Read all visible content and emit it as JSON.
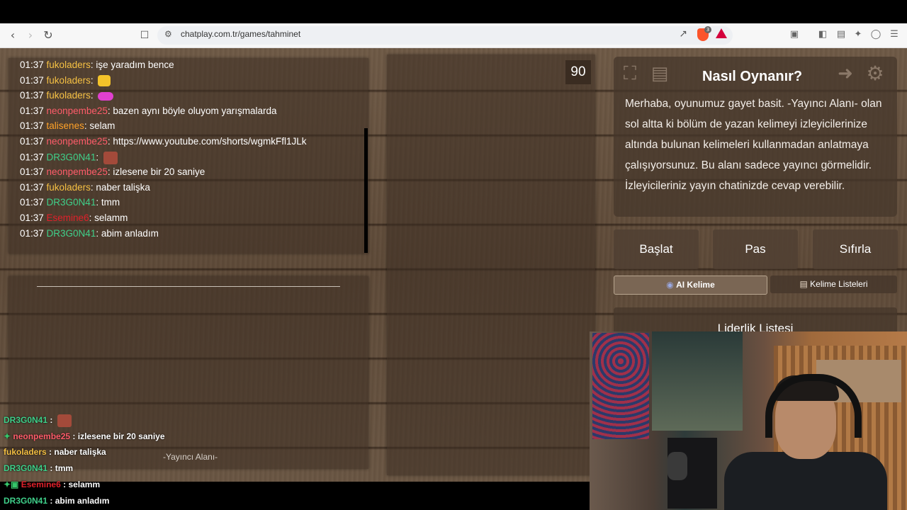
{
  "browser": {
    "url": "chatplay.com.tr/games/tahminet",
    "brave_badge": "3"
  },
  "chat": [
    {
      "time": "01:37",
      "user": "fukoladers",
      "color": "#f5c043",
      "sep": ": ",
      "msg": "işe yaradım bence",
      "emote": ""
    },
    {
      "time": "01:37",
      "user": "fukoladers",
      "color": "#f5c043",
      "sep": ": ",
      "msg": "",
      "emote": "cat"
    },
    {
      "time": "01:37",
      "user": "fukoladers",
      "color": "#f5c043",
      "sep": ": ",
      "msg": "",
      "emote": "bow"
    },
    {
      "time": "01:37",
      "user": "neonpembe25",
      "color": "#ff5c6a",
      "sep": ": ",
      "msg": "bazen aynı böyle oluyom yarışmalarda",
      "emote": ""
    },
    {
      "time": "01:37",
      "user": "talisenes",
      "color": "#ffa128",
      "sep": ": ",
      "msg": "selam",
      "emote": ""
    },
    {
      "time": "01:37",
      "user": "neonpembe25",
      "color": "#ff5c6a",
      "sep": ": ",
      "msg": "https://www.youtube.com/shorts/wgmkFfl1JLk",
      "emote": ""
    },
    {
      "time": "01:37",
      "user": "DR3G0N41",
      "color": "#3fd08a",
      "sep": ": ",
      "msg": "",
      "emote": "face"
    },
    {
      "time": "01:37",
      "user": "neonpembe25",
      "color": "#ff5c6a",
      "sep": ": ",
      "msg": "izlesene bir 20 saniye",
      "emote": ""
    },
    {
      "time": "01:37",
      "user": "fukoladers",
      "color": "#f5c043",
      "sep": ": ",
      "msg": "naber talişka",
      "emote": ""
    },
    {
      "time": "01:37",
      "user": "DR3G0N41",
      "color": "#3fd08a",
      "sep": ": ",
      "msg": "tmm",
      "emote": ""
    },
    {
      "time": "01:37",
      "user": "Esemine6",
      "color": "#e0202a",
      "sep": ": ",
      "msg": "selamm",
      "emote": ""
    },
    {
      "time": "01:37",
      "user": "DR3G0N41",
      "color": "#3fd08a",
      "sep": ": ",
      "msg": "abim anladım",
      "emote": ""
    }
  ],
  "streamer_area_label": "-Yayıncı Alanı-",
  "timer": "90",
  "help": {
    "title": "Nasıl Oynanır?",
    "text": "Merhaba, oyunumuz gayet basit. -Yayıncı Alanı- olan sol altta ki bölüm de yazan kelimeyi izleyicilerinize altında bulunan kelimeleri kullanmadan anlatmaya çalışıyorsunuz. Bu alanı sadece yayıncı görmelidir. İzleyicileriniz yayın chatinizde cevap verebilir."
  },
  "buttons": {
    "start": "Başlat",
    "pass": "Pas",
    "reset": "Sıfırla",
    "ai_word": "AI Kelime",
    "word_lists": "Kelime Listeleri"
  },
  "leaderboard": {
    "title": "Liderlik Listesi"
  },
  "overlay": [
    {
      "user": "DR3G0N41",
      "color": "#3fd08a",
      "msg": "",
      "emote": "face",
      "badge": ""
    },
    {
      "user": "neonpembe25",
      "color": "#ff5c6a",
      "msg": "izlesene bir 20 saniye",
      "emote": "",
      "badge": "star"
    },
    {
      "user": "fukoladers",
      "color": "#f5c043",
      "msg": "naber talişka",
      "emote": "",
      "badge": ""
    },
    {
      "user": "DR3G0N41",
      "color": "#3fd08a",
      "msg": "tmm",
      "emote": "",
      "badge": ""
    },
    {
      "user": "Esemine6",
      "color": "#e0202a",
      "msg": "selamm",
      "emote": "",
      "badge": "star-crown"
    },
    {
      "user": "DR3G0N41",
      "color": "#3fd08a",
      "msg": "abim anladım",
      "emote": "",
      "badge": ""
    }
  ]
}
